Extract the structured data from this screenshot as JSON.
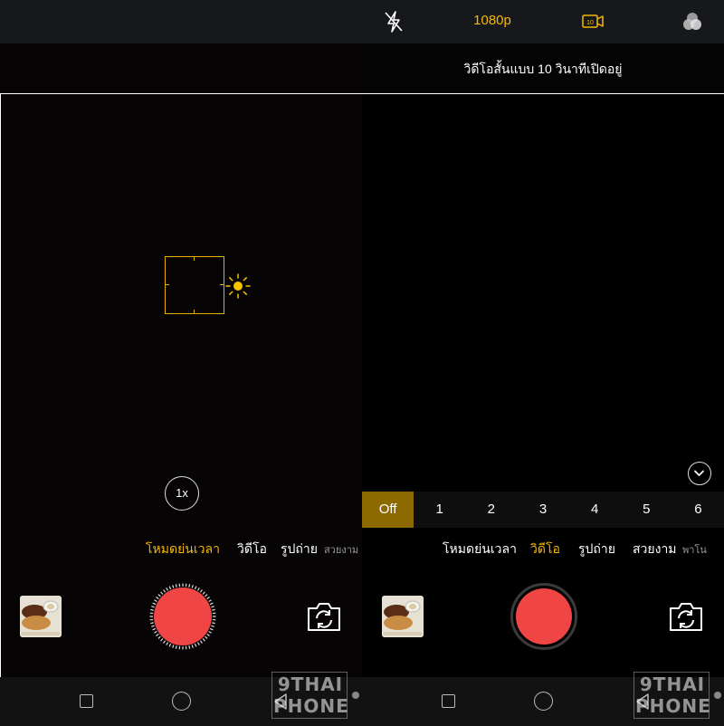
{
  "left_screen": {
    "zoom_label": "1x",
    "modes": [
      {
        "label": "โหมดย่นเวลา",
        "active": true
      },
      {
        "label": "วิดีโอ",
        "active": false
      },
      {
        "label": "รูปถ่าย",
        "active": false
      },
      {
        "label": "สวยงาม",
        "active": false
      }
    ]
  },
  "right_screen": {
    "topbar": {
      "flash_icon": "flash-off-icon",
      "resolution": "1080p",
      "short_video_badge": "10",
      "filter_icon": "color-filter-icon"
    },
    "tip_text": "วิดีโอสั้นแบบ 10 วินาทีเปิดอยู่",
    "timer_options": [
      "Off",
      "1",
      "2",
      "3",
      "4",
      "5",
      "6"
    ],
    "timer_selected": "Off",
    "modes": [
      {
        "label": "โหมดย่นเวลา",
        "active": false
      },
      {
        "label": "วิดีโอ",
        "active": true
      },
      {
        "label": "รูปถ่าย",
        "active": false
      },
      {
        "label": "สวยงาม",
        "active": false
      },
      {
        "label": "พาโน",
        "active": false
      }
    ]
  },
  "watermark": {
    "line1": "9THAI",
    "line2": "PHONE"
  },
  "colors": {
    "accent": "#f5b800",
    "record": "#ef4545",
    "timer_selected_bg": "#8d6a00"
  }
}
